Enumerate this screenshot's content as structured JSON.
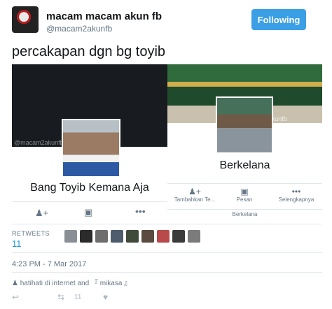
{
  "header": {
    "display_name": "macam macam akun fb",
    "handle": "@macam2akunfb",
    "follow_label": "Following",
    "follow_color": "#3b9fe6"
  },
  "tweet": {
    "text": "percakapan dgn bg toyib"
  },
  "card1": {
    "watermark": "@macam2akunfb",
    "name": "Bang Toyib Kemana Aja"
  },
  "card2": {
    "watermark": "@macam2akunfb",
    "name": "Berkelana",
    "actions": [
      {
        "icon": "add-friend-icon",
        "label": "Tambahkan Te..."
      },
      {
        "icon": "message-icon",
        "label": "Pesan"
      },
      {
        "icon": "more-icon",
        "label": "Selengkapnya"
      }
    ],
    "subtab": "Berkelana"
  },
  "stats": {
    "retweets_label": "RETWEETS",
    "retweets_count": "11"
  },
  "timestamp": "4:23 PM - 7 Mar 2017",
  "context": "hatihati di internet and 『 mikasa 』",
  "toolbar": {
    "retweet_count": "11"
  },
  "retweeter_avatar_colors": [
    "#8a8f96",
    "#2b2b2b",
    "#6e6e6e",
    "#4e5c6b",
    "#3f4a3a",
    "#5a4a3f",
    "#b84a4a",
    "#3a3a3a",
    "#7b7b7b"
  ]
}
